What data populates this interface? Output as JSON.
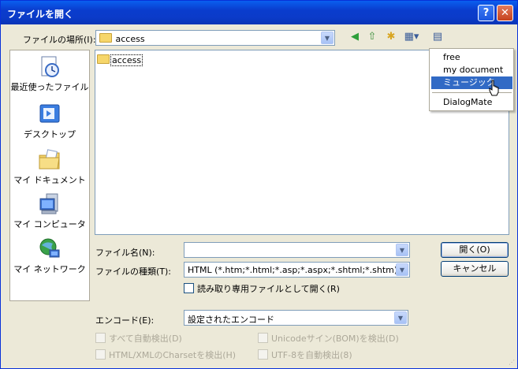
{
  "window": {
    "title": "ファイルを開く",
    "help_glyph": "?",
    "close_glyph": "✕"
  },
  "location": {
    "label": "ファイルの場所(I):",
    "value": "access"
  },
  "places": [
    {
      "label": "最近使ったファイル",
      "icon": "recent-documents-icon"
    },
    {
      "label": "デスクトップ",
      "icon": "desktop-icon"
    },
    {
      "label": "マイ ドキュメント",
      "icon": "my-documents-icon"
    },
    {
      "label": "マイ コンピュータ",
      "icon": "my-computer-icon"
    },
    {
      "label": "マイ ネットワーク",
      "icon": "my-network-icon"
    }
  ],
  "files": [
    {
      "name": "access",
      "type": "folder"
    }
  ],
  "filename": {
    "label": "ファイル名(N):",
    "value": ""
  },
  "filetype": {
    "label": "ファイルの種類(T):",
    "value": "HTML (*.htm;*.html;*.asp;*.aspx;*.shtml;*.shtm)"
  },
  "readonly_label": "読み取り専用ファイルとして開く(R)",
  "buttons": {
    "open": "開く(O)",
    "cancel": "キャンセル"
  },
  "encode": {
    "label": "エンコード(E):",
    "value": "設定されたエンコード"
  },
  "options": {
    "auto_detect": "すべて自動検出(D)",
    "unicode_sig": "Unicodeサイン(BOM)を検出(D)",
    "html_charset": "HTML/XMLのCharsetを検出(H)",
    "utf8_detect": "UTF-8を自動検出(8)"
  },
  "bookmark_menu": {
    "items": [
      "free",
      "my document",
      "ミュージック",
      "DialogMate"
    ],
    "selected": "ミュージック"
  },
  "colors": {
    "titlebar": "#0a3ccd",
    "dialog_bg": "#ece9d8",
    "selection": "#316ac5"
  }
}
